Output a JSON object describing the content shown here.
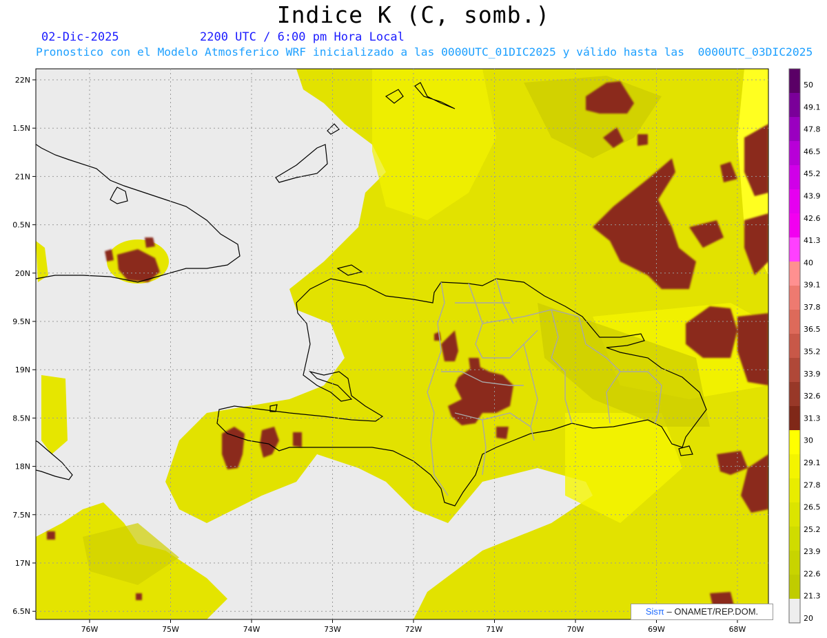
{
  "title": "Indice K (C, somb.)",
  "subtitle": {
    "date": "02-Dic-2025",
    "time": "2200 UTC / 6:00 pm Hora Local",
    "info": "Pronostico con el Modelo Atmosferico WRF inicializado a las 0000UTC_01DIC2025 y válido hasta las  0000UTC_03DIC2025"
  },
  "credit": {
    "logo": "Sisπ",
    "text": "– ONAMET/REP.DOM."
  },
  "axes": {
    "lon_labels": [
      "76W",
      "75W",
      "74W",
      "73W",
      "72W",
      "71W",
      "70W",
      "69W",
      "68W"
    ],
    "lat_labels": [
      "22N",
      "1.5N",
      "21N",
      "0.5N",
      "20N",
      "9.5N",
      "19N",
      "8.5N",
      "18N",
      "7.5N",
      "17N",
      "6.5N"
    ]
  },
  "colorbar": {
    "labels": [
      "50",
      "49.1",
      "47.8",
      "46.5",
      "45.2",
      "43.9",
      "42.6",
      "41.3",
      "40",
      "39.1",
      "37.8",
      "36.5",
      "35.2",
      "33.9",
      "32.6",
      "31.3",
      "30",
      "29.1",
      "27.8",
      "26.5",
      "25.2",
      "23.9",
      "22.6",
      "21.3",
      "20"
    ],
    "colors": [
      "#5a0066",
      "#7a0099",
      "#9a00c0",
      "#b800d8",
      "#d000e8",
      "#e600f0",
      "#f200f0",
      "#ff40ff",
      "#ff9090",
      "#ee7a70",
      "#dd6a5a",
      "#c85848",
      "#b04838",
      "#983828",
      "#802818",
      "#ffff00",
      "#f4f400",
      "#e8ec00",
      "#dce400",
      "#d0dc00",
      "#c8d400",
      "#c0cc00",
      "#eeeeee"
    ]
  },
  "field": {
    "min_color": "#eeeeee",
    "low_color": "#d6d600",
    "mid_color": "#e8e800",
    "high_color": "#ffff30",
    "hot_color": "#8b2a1a"
  }
}
